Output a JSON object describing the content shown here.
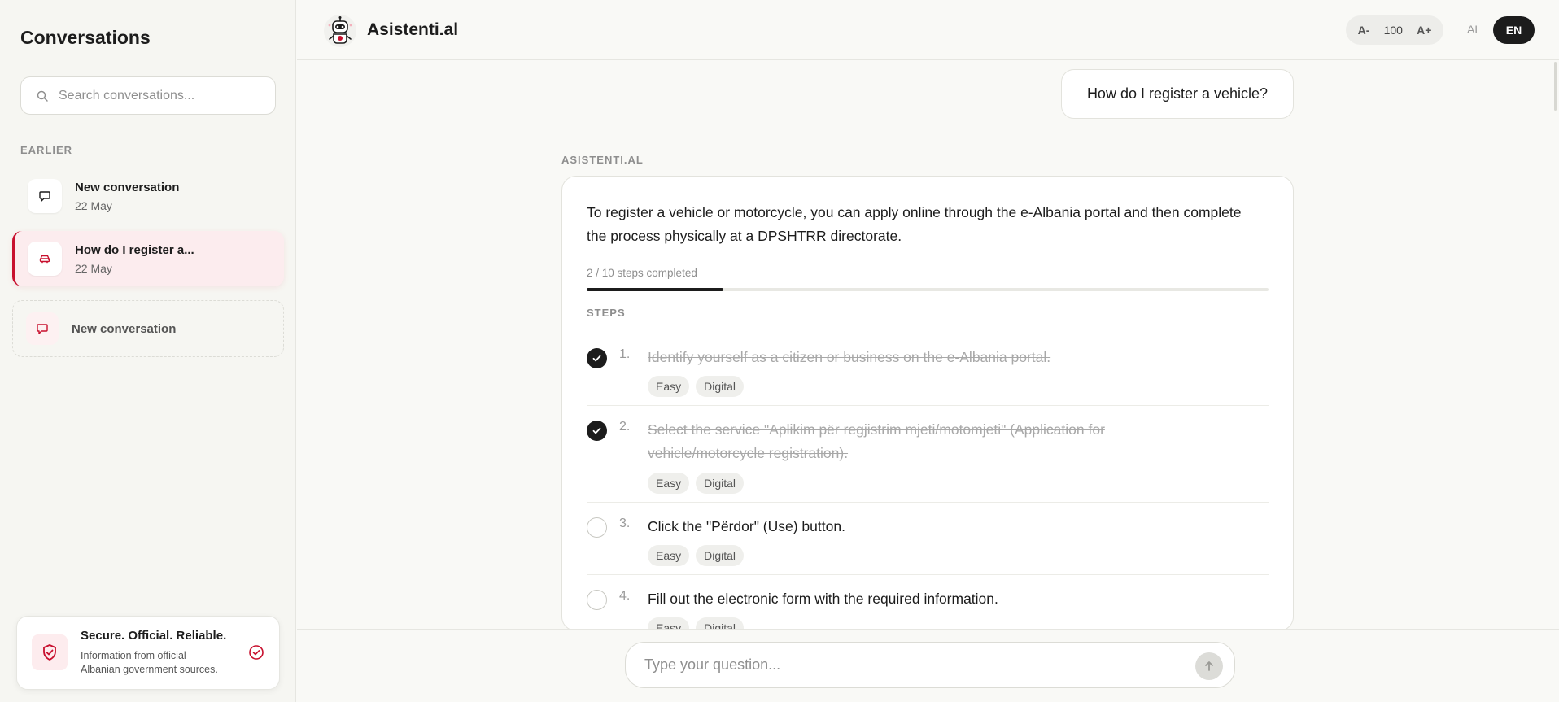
{
  "sidebar": {
    "title": "Conversations",
    "search_placeholder": "Search conversations...",
    "section_label": "EARLIER",
    "conversations": [
      {
        "title": "New conversation",
        "date": "22 May"
      },
      {
        "title": "How do I register a...",
        "date": "22 May"
      },
      {
        "title": "New conversation"
      }
    ],
    "trust": {
      "title": "Secure. Official. Reliable.",
      "desc": "Information from official Albanian government sources."
    }
  },
  "header": {
    "brand": "Asistenti.al",
    "font_decrease": "A-",
    "font_size": "100",
    "font_increase": "A+",
    "lang_al": "AL",
    "lang_en": "EN"
  },
  "chat": {
    "user_message": "How do I register a vehicle?",
    "assistant_label": "ASISTENTI.AL",
    "intro": "To register a vehicle or motorcycle, you can apply online through the e-Albania portal and then complete the process physically at a DPSHTRR directorate.",
    "progress_label": "2 / 10 steps completed",
    "progress_fraction": 0.2,
    "steps_label": "STEPS",
    "steps": [
      {
        "num": "1.",
        "text": "Identify yourself as a citizen or business on the e-Albania portal.",
        "done": true,
        "tags": [
          "Easy",
          "Digital"
        ]
      },
      {
        "num": "2.",
        "text": "Select the service \"Aplikim për regjistrim mjeti/motomjeti\" (Application for vehicle/motorcycle registration).",
        "done": true,
        "tags": [
          "Easy",
          "Digital"
        ]
      },
      {
        "num": "3.",
        "text": "Click the \"Përdor\" (Use) button.",
        "done": false,
        "tags": [
          "Easy",
          "Digital"
        ]
      },
      {
        "num": "4.",
        "text": "Fill out the electronic form with the required information.",
        "done": false,
        "tags": [
          "Easy",
          "Digital"
        ]
      }
    ]
  },
  "composer": {
    "placeholder": "Type your question..."
  },
  "colors": {
    "accent": "#c8102e",
    "dark": "#1c1c1c",
    "background": "#f9f9f6"
  }
}
